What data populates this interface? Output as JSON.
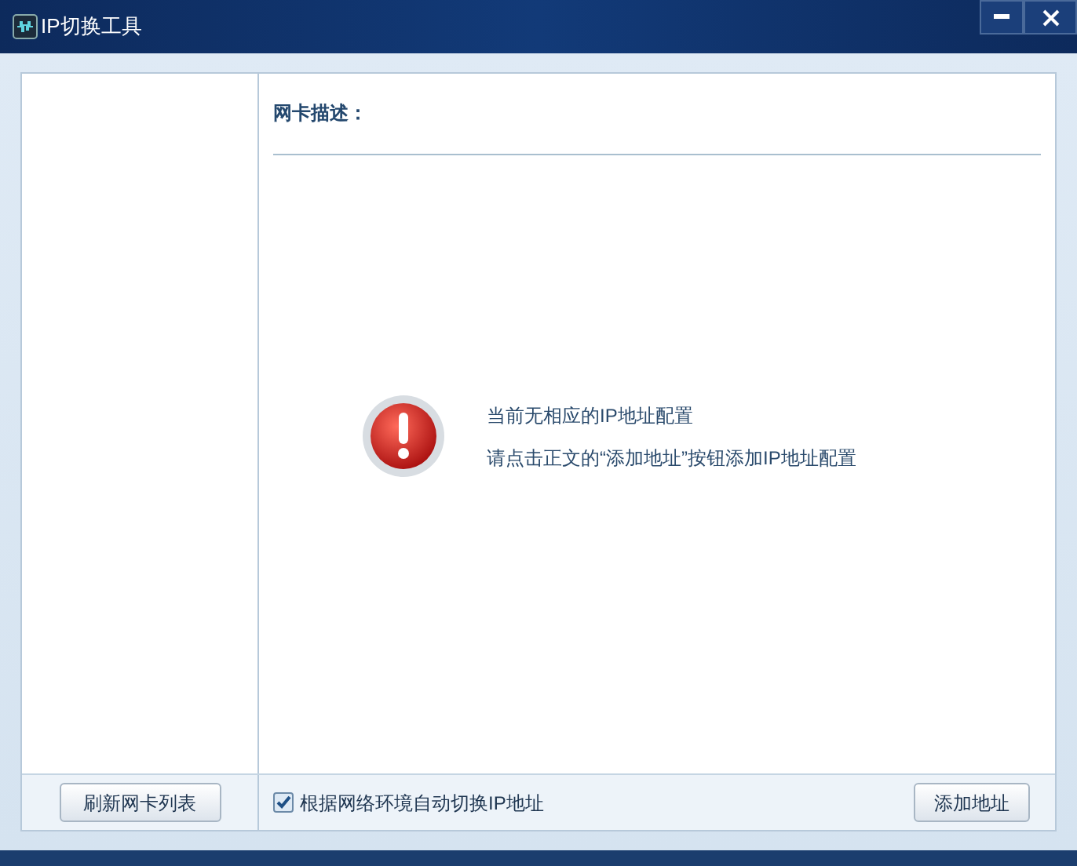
{
  "window": {
    "title": "IP切换工具"
  },
  "header": {
    "label": "网卡描述："
  },
  "message": {
    "lines": [
      "当前无相应的IP地址配置",
      "请点击正文的“添加地址”按钮添加IP地址配置"
    ]
  },
  "footer": {
    "refresh_button": "刷新网卡列表",
    "auto_switch": {
      "label": "根据网络环境自动切换IP地址",
      "checked": true
    },
    "add_button": "添加地址"
  }
}
